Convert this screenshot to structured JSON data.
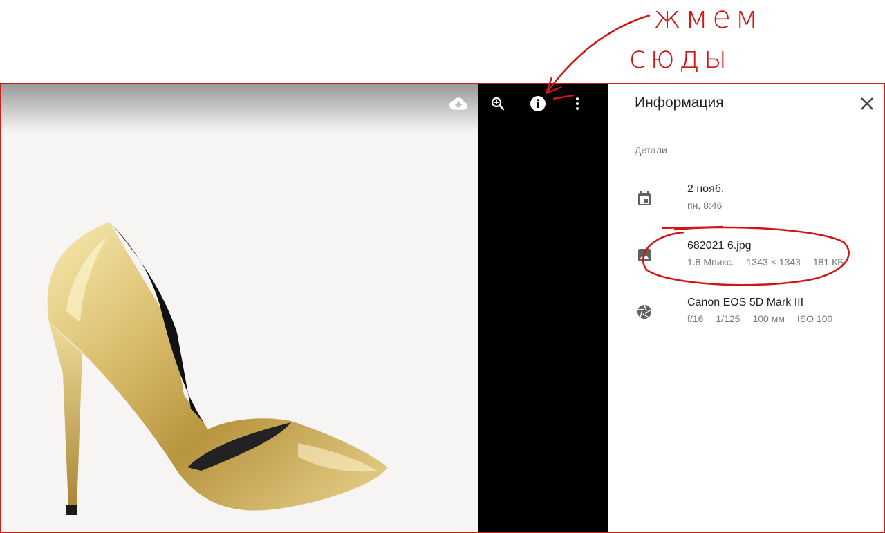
{
  "annotation": {
    "line1": "жмем",
    "line2": "сюды",
    "color": "#d21414"
  },
  "viewer": {
    "toolbar": {
      "download_icon": "cloud-download-icon",
      "zoom_icon": "zoom-in-icon",
      "info_icon": "info-icon",
      "more_icon": "more-vert-icon"
    }
  },
  "info_panel": {
    "title": "Информация",
    "close_icon": "close-icon",
    "section_label": "Детали",
    "date": {
      "icon": "calendar-icon",
      "primary": "2 нояб.",
      "secondary": "пн, 8:46"
    },
    "file": {
      "icon": "image-icon",
      "name": "682021 6.jpg",
      "megapixels": "1.8 Мпикс.",
      "dimensions": "1343 × 1343",
      "size": "181 КБ"
    },
    "camera": {
      "icon": "aperture-icon",
      "model": "Canon EOS 5D Mark III",
      "aperture": "f/16",
      "shutter": "1/125",
      "focal": "100 мм",
      "iso": "ISO 100"
    }
  }
}
